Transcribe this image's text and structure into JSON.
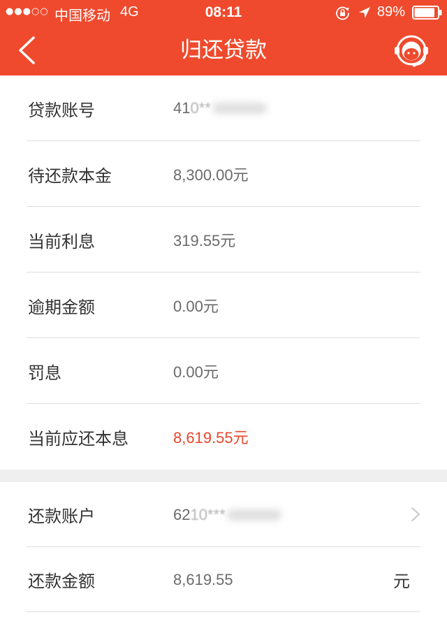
{
  "colors": {
    "header_bg": "#EF4A2D",
    "highlight": "#E8472E",
    "gap_bg": "#EFEFEF"
  },
  "status_bar": {
    "signal": "●●●○○",
    "carrier": "中国移动",
    "network": "4G",
    "time": "08:11",
    "battery_text": "89%",
    "battery_level": 0.89,
    "icons": [
      "rotation-lock-icon",
      "location-arrow-icon",
      "battery-icon"
    ]
  },
  "nav": {
    "title": "归还贷款",
    "back_icon": "chevron-left-icon",
    "service_icon": "customer-service-icon"
  },
  "loan_info": {
    "rows": [
      {
        "label": "贷款账号",
        "value_clear": "41",
        "value_masked": "0**"
      },
      {
        "label": "待还款本金",
        "value": "8,300.00元"
      },
      {
        "label": "当前利息",
        "value": "319.55元"
      },
      {
        "label": "逾期金额",
        "value": "0.00元"
      },
      {
        "label": "罚息",
        "value": "0.00元"
      },
      {
        "label": "当前应还本息",
        "value": "8,619.55元",
        "highlight": true
      }
    ]
  },
  "repayment": {
    "rows": [
      {
        "label": "还款账户",
        "value_clear": "62",
        "value_masked": "10***",
        "icon": "chevron-right-icon"
      },
      {
        "label": "还款金额",
        "value": "8,619.55",
        "unit": "元"
      }
    ]
  }
}
